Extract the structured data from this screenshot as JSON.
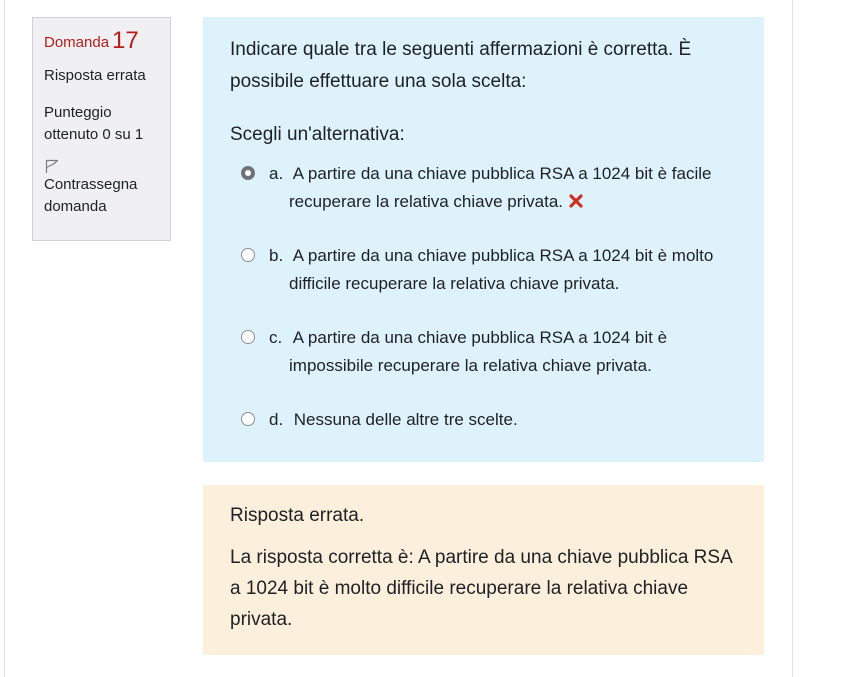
{
  "question_info": {
    "label": "Domanda",
    "number": "17",
    "state": "Risposta errata",
    "grade": "Punteggio ottenuto 0 su 1",
    "flag_label": "Contrassegna domanda",
    "flag_icon": "flag-outline-icon"
  },
  "question": {
    "text": "Indicare quale tra le seguenti affermazioni è corretta. È possibile effettuare una sola scelta:",
    "prompt": "Scegli un'alternativa:",
    "options": [
      {
        "letter": "a.",
        "text": "A partire da una chiave pubblica RSA a 1024 bit è facile recuperare la relativa chiave privata.",
        "selected": true,
        "marked_wrong": true
      },
      {
        "letter": "b.",
        "text": "A partire da una chiave pubblica RSA a 1024 bit è molto difficile recuperare la relativa chiave privata.",
        "selected": false,
        "marked_wrong": false
      },
      {
        "letter": "c.",
        "text": "A partire da una chiave pubblica RSA a 1024 bit è impossibile recuperare la relativa chiave privata.",
        "selected": false,
        "marked_wrong": false
      },
      {
        "letter": "d.",
        "text": "Nessuna delle altre tre scelte.",
        "selected": false,
        "marked_wrong": false
      }
    ],
    "wrong_icon": "red-cross-icon"
  },
  "feedback": {
    "result": "Risposta errata.",
    "right_answer": "La risposta corretta è: A partire da una chiave pubblica RSA a 1024 bit è molto difficile recuperare la relativa chiave privata."
  },
  "colors": {
    "question_number": "#b51d1d",
    "formulation_bg": "#def2fb",
    "feedback_bg": "#fcefdc",
    "info_bg": "#f0f0f2",
    "wrong_mark": "#ca3120"
  }
}
